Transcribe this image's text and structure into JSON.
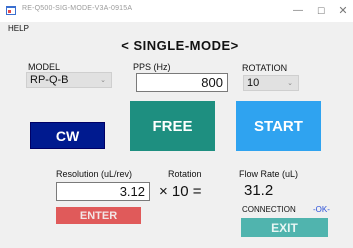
{
  "window": {
    "title": "RE-Q500-SIG-MODE-V3A-0915A",
    "minimize": "—",
    "maximize": "☐",
    "close": "✕"
  },
  "menu": {
    "help": "HELP"
  },
  "heading": "< SINGLE-MODE>",
  "model": {
    "label": "MODEL",
    "value": "RP-Q-B"
  },
  "pps": {
    "label": "PPS (Hz)",
    "value": "800"
  },
  "rotation_select": {
    "label": "ROTATION",
    "value": "10"
  },
  "buttons": {
    "cw": "CW",
    "free": "FREE",
    "start": "START",
    "enter": "ENTER",
    "exit": "EXIT"
  },
  "calc": {
    "resolution_label": "Resolution  (uL/rev)",
    "rotation_label": "Rotation",
    "flow_label": "Flow Rate (uL)",
    "resolution_value": "3.12",
    "times_text": "× 10 =",
    "flow_value": "31.2"
  },
  "connection": {
    "label": "CONNECTION",
    "status": "-OK-"
  },
  "colors": {
    "cw": "#001a8f",
    "free": "#1e8f80",
    "start": "#2fa3f0",
    "enter": "#e05a5a",
    "exit": "#50b4ae",
    "ok": "#2a4fd8"
  },
  "icons": {
    "app": "app-window-icon",
    "dropdown": "chevron-down-icon"
  }
}
